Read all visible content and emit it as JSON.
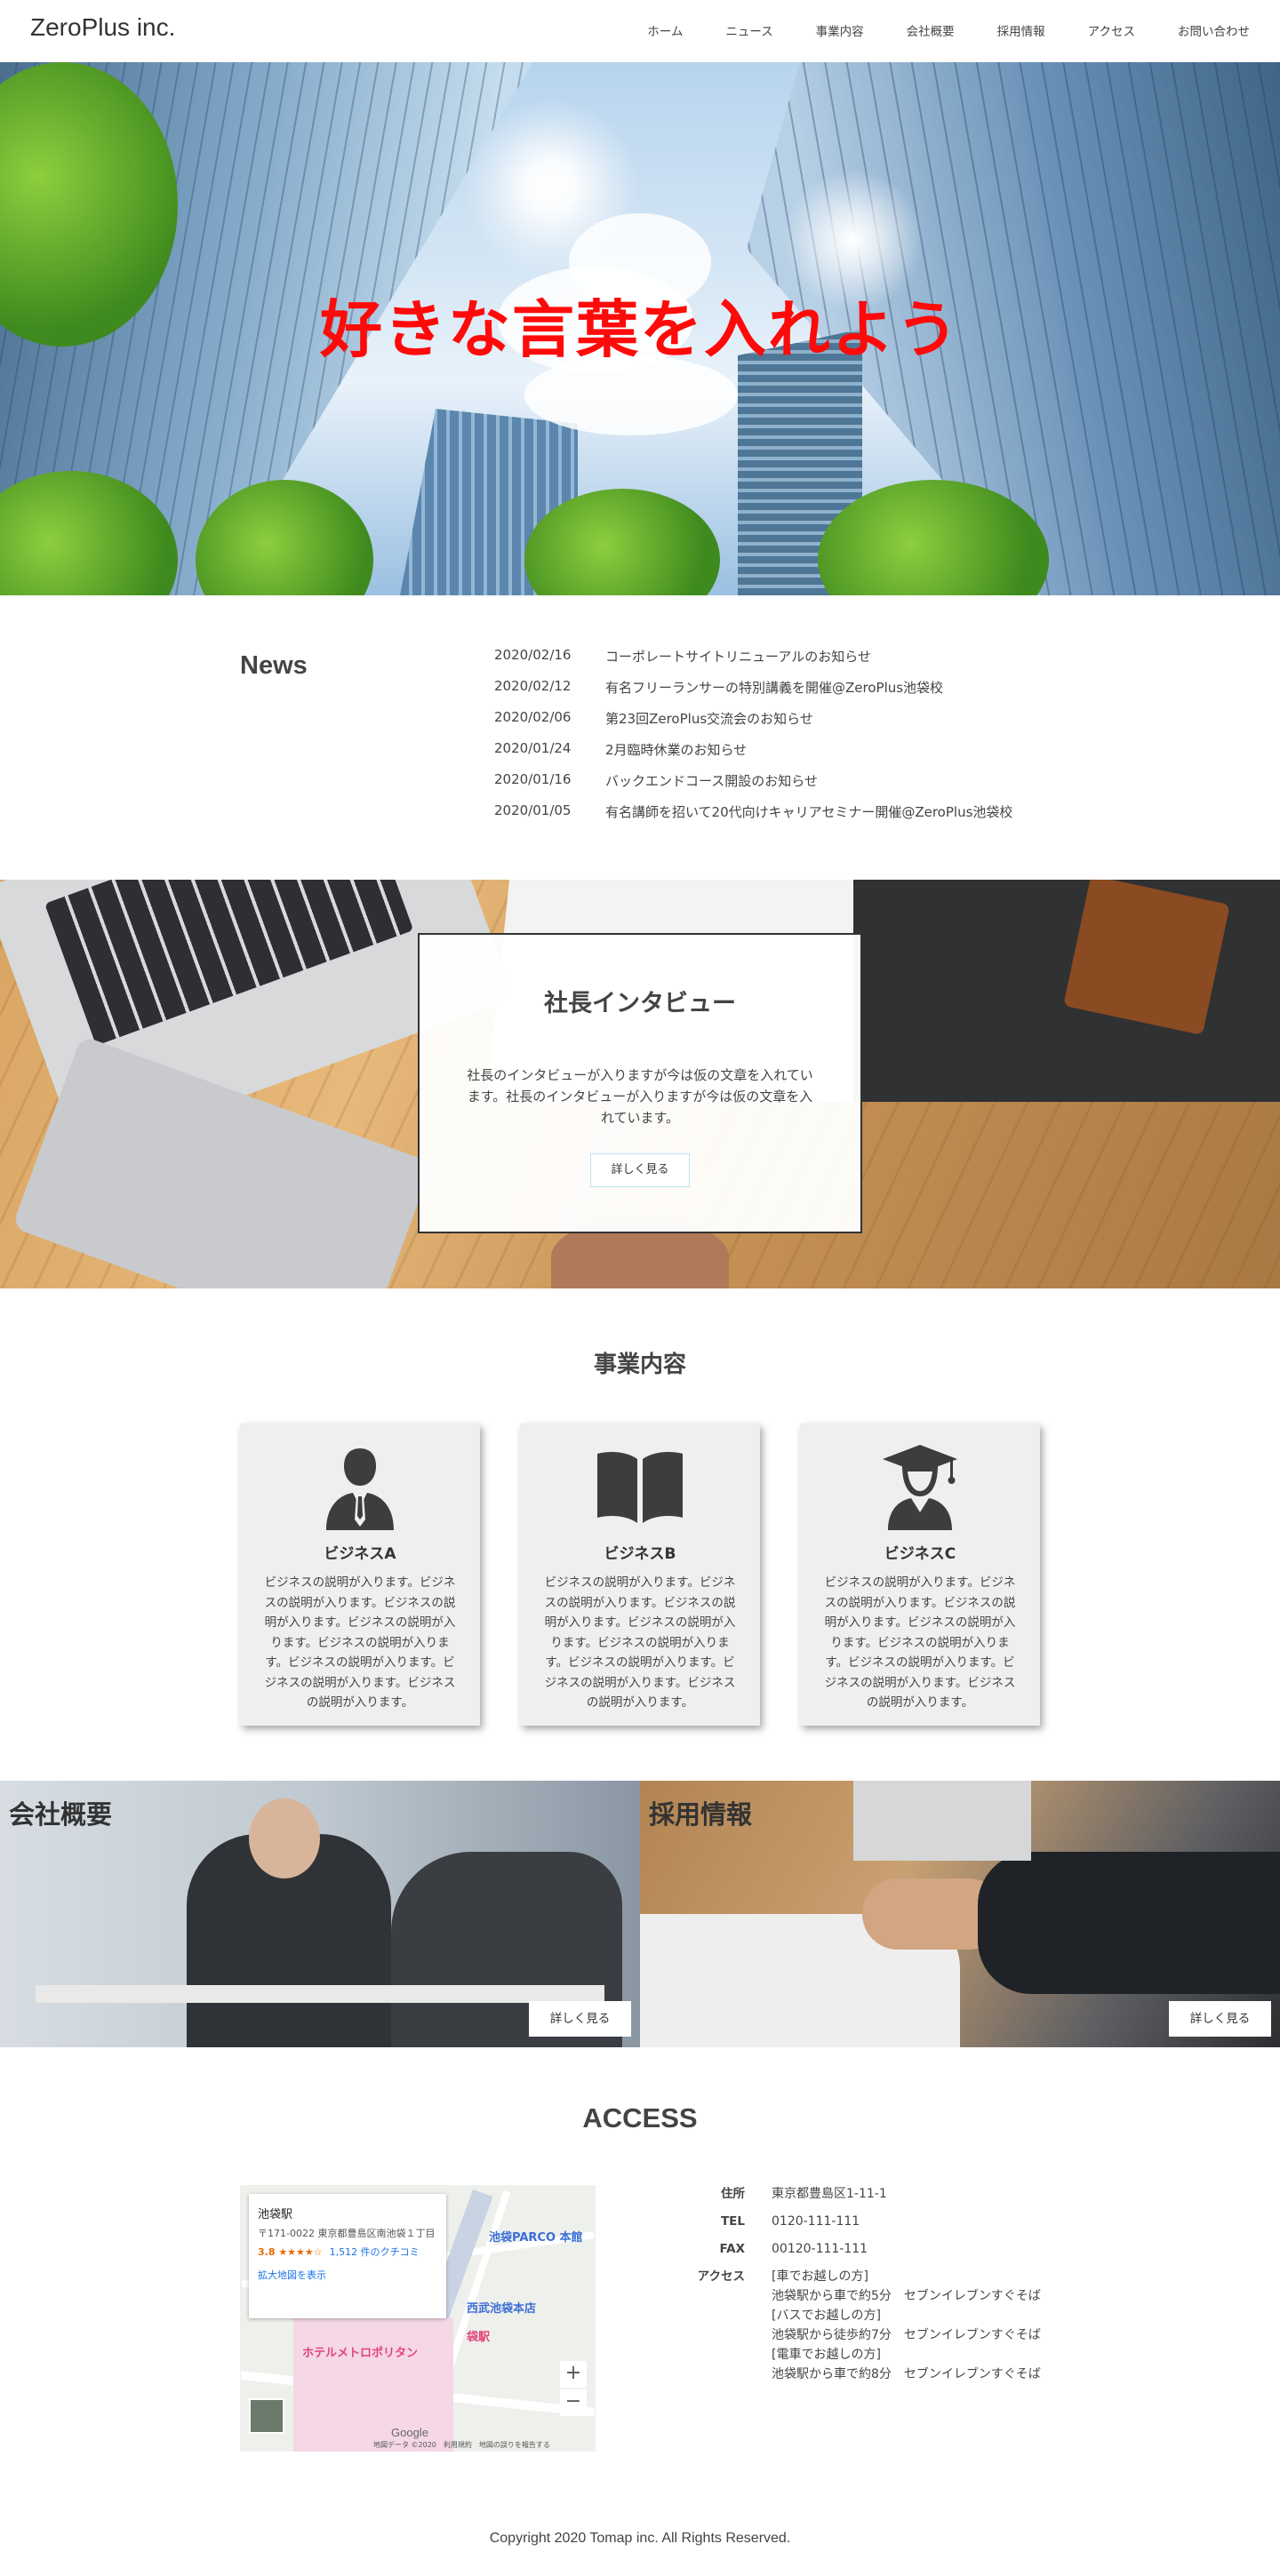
{
  "header": {
    "logo": "ZeroPlus inc.",
    "nav": [
      "ホーム",
      "ニュース",
      "事業内容",
      "会社概要",
      "採用情報",
      "アクセス",
      "お問い合わせ"
    ]
  },
  "hero": {
    "title": "好きな言葉を入れよう"
  },
  "news": {
    "title": "News",
    "items": [
      {
        "date": "2020/02/16",
        "text": "コーポレートサイトリニューアルのお知らせ"
      },
      {
        "date": "2020/02/12",
        "text": "有名フリーランサーの特別講義を開催@ZeroPlus池袋校"
      },
      {
        "date": "2020/02/06",
        "text": "第23回ZeroPlus交流会のお知らせ"
      },
      {
        "date": "2020/01/24",
        "text": "2月臨時休業のお知らせ"
      },
      {
        "date": "2020/01/16",
        "text": "バックエンドコース開設のお知らせ"
      },
      {
        "date": "2020/01/05",
        "text": "有名講師を招いて20代向けキャリアセミナー開催@ZeroPlus池袋校"
      }
    ]
  },
  "interview": {
    "title": "社長インタビュー",
    "text": "社長のインタビューが入りますが今は仮の文章を入れています。社長のインタビューが入りますが今は仮の文章を入れています。",
    "button": "詳しく見る"
  },
  "services": {
    "title": "事業内容",
    "items": [
      {
        "name": "ビジネスA",
        "icon": "businessman-icon",
        "text": "ビジネスの説明が入ります。ビジネスの説明が入ります。ビジネスの説明が入ります。ビジネスの説明が入ります。ビジネスの説明が入ります。ビジネスの説明が入ります。ビジネスの説明が入ります。ビジネスの説明が入ります。"
      },
      {
        "name": "ビジネスB",
        "icon": "book-icon",
        "text": "ビジネスの説明が入ります。ビジネスの説明が入ります。ビジネスの説明が入ります。ビジネスの説明が入ります。ビジネスの説明が入ります。ビジネスの説明が入ります。ビジネスの説明が入ります。ビジネスの説明が入ります。"
      },
      {
        "name": "ビジネスC",
        "icon": "graduate-icon",
        "text": "ビジネスの説明が入ります。ビジネスの説明が入ります。ビジネスの説明が入ります。ビジネスの説明が入ります。ビジネスの説明が入ります。ビジネスの説明が入ります。ビジネスの説明が入ります。ビジネスの説明が入ります。"
      }
    ]
  },
  "company": {
    "title": "会社概要",
    "button": "詳しく見る"
  },
  "recruit": {
    "title": "採用情報",
    "button": "詳しく見る"
  },
  "access": {
    "title": "ACCESS",
    "map": {
      "place": "池袋駅",
      "address": "〒171-0022 東京都豊島区南池袋１丁目",
      "rating": "3.8 ★★★★☆",
      "reviews": "1,512 件のクチコミ",
      "link": "拡大地図を表示",
      "label_parco": "池袋PARCO 本館",
      "label_seibu": "西武池袋本店",
      "label_hotel": "ホテルメトロポリタン",
      "label_station": "袋駅",
      "zoom_in": "+",
      "zoom_out": "−",
      "google": "Google",
      "footer": "地図データ ©2020　利用規約　地図の誤りを報告する"
    },
    "info": {
      "address_label": "住所",
      "address": "東京都豊島区1-11-1",
      "tel_label": "TEL",
      "tel": "0120-111-111",
      "fax_label": "FAX",
      "fax": "00120-111-111",
      "access_label": "アクセス",
      "access_lines": [
        "[車でお越しの方]",
        "池袋駅から車で約5分　セブンイレブンすぐそば",
        "[バスでお越しの方]",
        "池袋駅から徒歩約7分　セブンイレブンすぐそば",
        "[電車でお越しの方]",
        "池袋駅から車で約8分　セブンイレブンすぐそば"
      ]
    }
  },
  "footer": {
    "copyright": "Copyright 2020 Tomap inc. All Rights Reserved."
  }
}
